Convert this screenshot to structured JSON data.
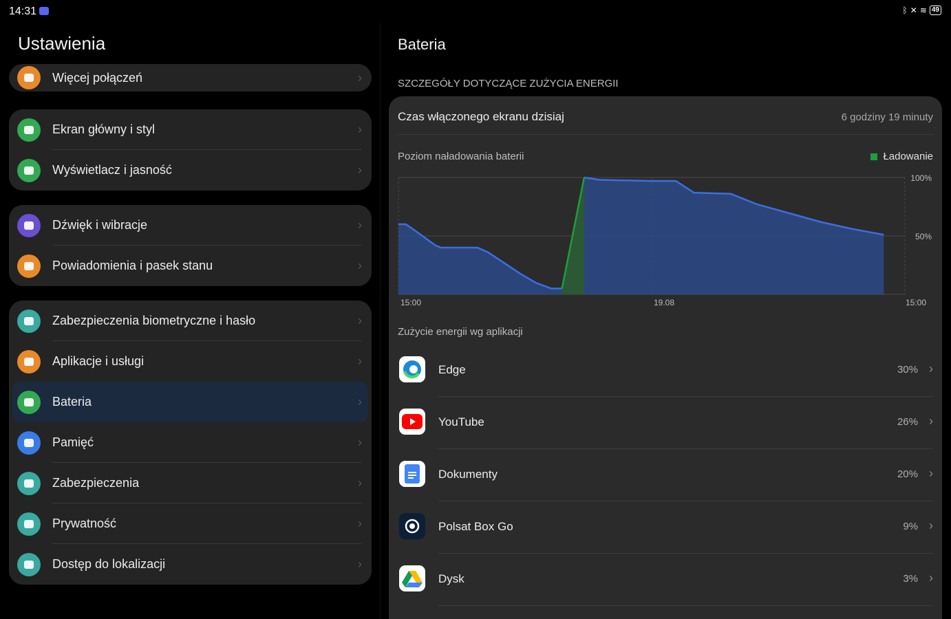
{
  "status": {
    "time": "14:31",
    "battery": "49"
  },
  "left": {
    "title": "Ustawienia",
    "groups": [
      {
        "items": [
          {
            "label": "Więcej połączeń",
            "icon": "link-icon",
            "color": "#e88a2b"
          }
        ]
      },
      {
        "items": [
          {
            "label": "Ekran główny i styl",
            "icon": "image-icon",
            "color": "#34a853"
          },
          {
            "label": "Wyświetlacz i jasność",
            "icon": "eye-icon",
            "color": "#34a853"
          }
        ]
      },
      {
        "items": [
          {
            "label": "Dźwięk i wibracje",
            "icon": "speaker-icon",
            "color": "#6a4fd1"
          },
          {
            "label": "Powiadomienia i pasek stanu",
            "icon": "bell-icon",
            "color": "#e88a2b"
          }
        ]
      },
      {
        "items": [
          {
            "label": "Zabezpieczenia biometryczne i hasło",
            "icon": "key-icon",
            "color": "#3aa99f"
          },
          {
            "label": "Aplikacje i usługi",
            "icon": "grid-icon",
            "color": "#e88a2b"
          },
          {
            "label": "Bateria",
            "icon": "battery-icon",
            "color": "#34a853",
            "selected": true
          },
          {
            "label": "Pamięć",
            "icon": "storage-icon",
            "color": "#3b7be8"
          },
          {
            "label": "Zabezpieczenia",
            "icon": "shield-check-icon",
            "color": "#3aa99f"
          },
          {
            "label": "Prywatność",
            "icon": "shield-lock-icon",
            "color": "#3aa99f"
          },
          {
            "label": "Dostęp do lokalizacji",
            "icon": "location-icon",
            "color": "#3aa99f"
          }
        ]
      }
    ]
  },
  "right": {
    "title": "Bateria",
    "section": "SZCZEGÓŁY DOTYCZĄCE ZUŻYCIA ENERGII",
    "screen_on_label": "Czas włączonego ekranu dzisiaj",
    "screen_on_value": "6 godziny 19 minuty",
    "chart_label": "Poziom naładowania baterii",
    "legend_label": "Ładowanie",
    "apps_caption": "Zużycie energii wg aplikacji",
    "apps": [
      {
        "name": "Edge",
        "percent": "30%",
        "icon": "edge-icon"
      },
      {
        "name": "YouTube",
        "percent": "26%",
        "icon": "youtube-icon"
      },
      {
        "name": "Dokumenty",
        "percent": "20%",
        "icon": "docs-icon"
      },
      {
        "name": "Polsat Box Go",
        "percent": "9%",
        "icon": "polsat-icon"
      },
      {
        "name": "Dysk",
        "percent": "3%",
        "icon": "drive-icon"
      }
    ]
  },
  "chart_data": {
    "type": "area",
    "title": "Poziom naładowania baterii",
    "x_ticks": [
      "15:00",
      "19.08",
      "15:00"
    ],
    "y_ticks": [
      "100%",
      "50%"
    ],
    "ylim": [
      0,
      100
    ],
    "xlim": [
      0,
      24
    ],
    "grid": true,
    "legend": "top-right",
    "series": [
      {
        "name": "Ładowanie",
        "color": "#1e9e3a",
        "points": [
          [
            15.5,
            5
          ],
          [
            17.6,
            100
          ]
        ]
      }
    ],
    "level_series": {
      "color": "#3b6fe0",
      "points": [
        [
          0,
          60
        ],
        [
          0.7,
          60
        ],
        [
          1.5,
          55
        ],
        [
          3.5,
          42
        ],
        [
          4,
          40
        ],
        [
          7.5,
          40
        ],
        [
          8.5,
          36
        ],
        [
          11.5,
          18
        ],
        [
          13,
          10
        ],
        [
          14.5,
          5
        ],
        [
          15.5,
          5
        ],
        [
          17.6,
          100
        ],
        [
          19,
          98
        ],
        [
          24,
          97
        ],
        [
          26.3,
          97
        ],
        [
          28,
          87
        ],
        [
          31.5,
          86
        ],
        [
          34,
          77
        ],
        [
          40,
          62
        ],
        [
          43,
          56
        ],
        [
          46,
          51
        ]
      ]
    }
  }
}
